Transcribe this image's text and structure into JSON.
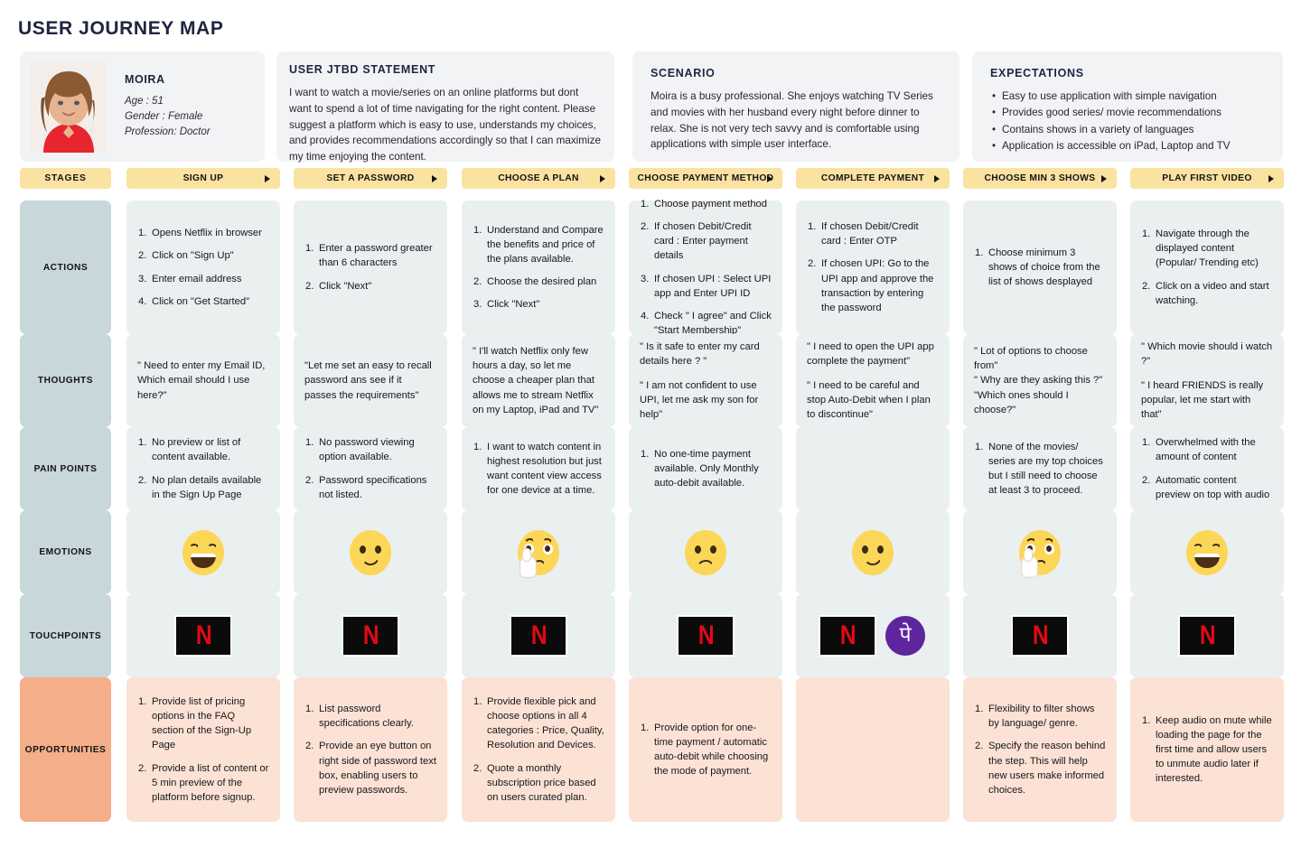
{
  "title": "USER JOURNEY MAP",
  "persona": {
    "name": "MOIRA",
    "age": "Age : 51",
    "gender": "Gender : Female",
    "profession": "Profession: Doctor",
    "photo_alt": "persona-photo"
  },
  "jtbd": {
    "heading": "USER JTBD STATEMENT",
    "body": "I want to watch a movie/series on an online platforms but dont want to spend a lot of time navigating for the right content. Please suggest a platform which is easy to use, understands my choices, and provides recommendations accordingly so that I can maximize my time enjoying the content."
  },
  "scenario": {
    "heading": "SCENARIO",
    "body": "Moira is a busy professional. She enjoys watching TV Series and movies with her husband every night before dinner to relax.  She is not very tech savvy and is comfortable using applications with simple user interface."
  },
  "expectations": {
    "heading": "EXPECTATIONS",
    "items": [
      "Easy to use application with simple navigation",
      "Provides good series/ movie recommendations",
      "Contains shows in a variety of languages",
      "Application is accessible on iPad, Laptop and TV"
    ]
  },
  "row_labels": {
    "stages": "STAGES",
    "actions": "ACTIONS",
    "thoughts": "THOUGHTS",
    "pain_points": "PAIN POINTS",
    "emotions": "EMOTIONS",
    "touchpoints": "TOUCHPOINTS",
    "opportunities": "OPPORTUNITIES"
  },
  "stages": [
    "SIGN UP",
    "SET A PASSWORD",
    "CHOOSE A PLAN",
    "CHOOSE PAYMENT METHOD",
    "COMPLETE PAYMENT",
    "CHOOSE MIN 3 SHOWS",
    "PLAY FIRST VIDEO"
  ],
  "actions": [
    [
      "Opens Netflix in browser",
      "Click on \"Sign Up\"",
      "Enter email address",
      "Click on \"Get Started\""
    ],
    [
      "Enter a password greater than 6 characters",
      "Click \"Next\""
    ],
    [
      "Understand and Compare the benefits and price of the plans available.",
      "Choose the desired plan",
      "Click \"Next\""
    ],
    [
      "Choose payment method",
      "If chosen Debit/Credit card : Enter payment details",
      "If chosen UPI : Select UPI app and Enter UPI ID",
      "Check \" I agree\" and Click \"Start Membership\""
    ],
    [
      "If chosen Debit/Credit card : Enter OTP",
      "If chosen UPI: Go to the UPI app and approve the transaction by entering the password"
    ],
    [
      "Choose minimum 3 shows of choice from the list of shows desplayed"
    ],
    [
      "Navigate through the displayed content (Popular/ Trending etc)",
      "Click on a video and start watching."
    ]
  ],
  "thoughts": [
    [
      "\" Need to enter my Email ID, Which email should I use here?\""
    ],
    [
      "\"Let me set an easy to recall password ans see if it passes the requirements\""
    ],
    [
      "\" I'll watch Netflix only few hours a day, so let me choose a cheaper plan that allows me to stream Netflix on my Laptop, iPad and TV\""
    ],
    [
      "\" Is it safe to enter my card details here ? \"",
      "\" I am not confident to use UPI, let me ask my son for help\""
    ],
    [
      "\" I need to open the UPI app complete the payment\"",
      "\" I need to be careful and stop Auto-Debit when I plan to discontinue\""
    ],
    [
      "\" Lot of options to choose from\"",
      "\" Why are they asking this ?\"",
      "\"Which ones should I choose?\""
    ],
    [
      "\" Which movie should i watch ?\"",
      "\" I heard FRIENDS is really popular, let me start with that\""
    ]
  ],
  "pain_points": [
    [
      "No preview or list of content available.",
      "No plan details available in the Sign Up Page"
    ],
    [
      "No password viewing option available.",
      "Password specifications not listed."
    ],
    [
      "I want to watch content in highest resolution but just want content view access for one device at a time."
    ],
    [
      "No one-time payment available. Only Monthly auto-debit available."
    ],
    [],
    [
      "None of the movies/ series are my top choices but I still need to choose at least 3 to proceed."
    ],
    [
      "Overwhelmed with the amount of content",
      "Automatic content preview on top with audio"
    ]
  ],
  "emotions": [
    "laughing-face",
    "smiling-face",
    "thinking-face",
    "confused-face",
    "smiling-face",
    "thinking-face",
    "laughing-face"
  ],
  "touchpoints": [
    [
      "netflix-logo"
    ],
    [
      "netflix-logo"
    ],
    [
      "netflix-logo"
    ],
    [
      "netflix-logo"
    ],
    [
      "netflix-logo",
      "phonepe-logo"
    ],
    [
      "netflix-logo"
    ],
    [
      "netflix-logo"
    ]
  ],
  "logos": {
    "netflix_letter": "N",
    "phonepe_glyph": "पे"
  },
  "opportunities": [
    [
      "Provide list of pricing options in the FAQ section of the Sign-Up Page",
      "Provide a list of content or 5 min preview of the platform before signup."
    ],
    [
      "List password specifications clearly.",
      "Provide an eye button on right side of password text box, enabling users to preview passwords."
    ],
    [
      "Provide flexible pick and choose options in all 4 categories : Price, Quality, Resolution and Devices.",
      "Quote a monthly subscription price based on users curated plan."
    ],
    [
      "Provide option for one-time payment / automatic auto-debit while choosing the mode of payment."
    ],
    [],
    [
      "Flexibility to filter shows by language/ genre.",
      "Specify the reason behind the step. This will help new users make informed choices."
    ],
    [
      "Keep audio on mute while loading the page for the first time and allow users to unmute audio later if interested."
    ]
  ],
  "colors": {
    "stage_bar": "#fae2a0",
    "row_label": "#c8d7d9",
    "row_label_opportunities": "#f4ae89",
    "cell": "#eaeff0",
    "cell_opportunities": "#fbe2d4",
    "header_card": "#f2f3f5",
    "netflix_red": "#e50914",
    "phonepe_purple": "#5f259f",
    "title": "#1f2440"
  }
}
